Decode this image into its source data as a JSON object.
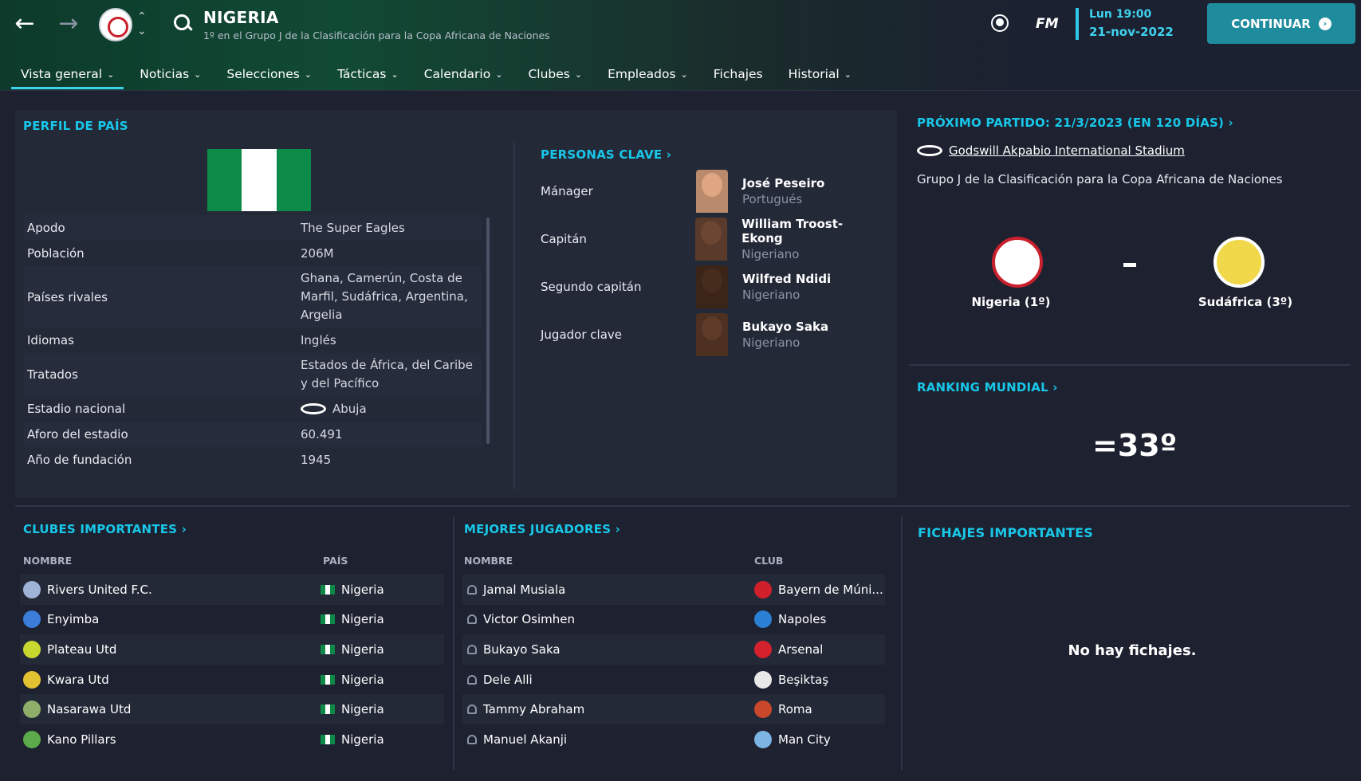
{
  "header": {
    "title": "NIGERIA",
    "subtitle": "1º en el Grupo J de la Clasificación para la Copa Africana de Naciones",
    "app_logo": "FM",
    "time": "Lun 19:00",
    "date": "21-nov-2022",
    "continue_label": "CONTINUAR"
  },
  "menu": [
    {
      "label": "Vista general",
      "has_dropdown": true,
      "active": true
    },
    {
      "label": "Noticias",
      "has_dropdown": true
    },
    {
      "label": "Selecciones",
      "has_dropdown": true
    },
    {
      "label": "Tácticas",
      "has_dropdown": true
    },
    {
      "label": "Calendario",
      "has_dropdown": true
    },
    {
      "label": "Clubes",
      "has_dropdown": true
    },
    {
      "label": "Empleados",
      "has_dropdown": true
    },
    {
      "label": "Fichajes",
      "has_dropdown": false
    },
    {
      "label": "Historial",
      "has_dropdown": true
    }
  ],
  "profile": {
    "title": "PERFIL DE PAÍS",
    "flag_colors": [
      "#0e8a48",
      "#ffffff",
      "#0e8a48"
    ],
    "rows": [
      {
        "label": "Apodo",
        "value": "The Super Eagles"
      },
      {
        "label": "Población",
        "value": "206M"
      },
      {
        "label": "Países rivales",
        "value": "Ghana, Camerún, Costa de Marfil, Sudáfrica, Argentina, Argelia"
      },
      {
        "label": "Idiomas",
        "value": "Inglés"
      },
      {
        "label": "Tratados",
        "value": "Estados de África, del Caribe y del Pacífico"
      },
      {
        "label": "Estadio nacional",
        "value": "Abuja",
        "icon": "stadium-icon"
      },
      {
        "label": "Aforo del estadio",
        "value": "60.491"
      },
      {
        "label": "Año de fundación",
        "value": "1945"
      }
    ]
  },
  "key_people": {
    "title": "PERSONAS CLAVE",
    "rows": [
      {
        "role": "Mánager",
        "name": "José Peseiro",
        "nationality": "Portugués",
        "face": "#b98a6c"
      },
      {
        "role": "Capitán",
        "name": "William Troost-Ekong",
        "nationality": "Nigeriano",
        "face": "#5a3a2a"
      },
      {
        "role": "Segundo capitán",
        "name": "Wilfred Ndidi",
        "nationality": "Nigeriano",
        "face": "#3a2518"
      },
      {
        "role": "Jugador clave",
        "name": "Bukayo Saka",
        "nationality": "Nigeriano",
        "face": "#4e3022"
      }
    ]
  },
  "next_match": {
    "title": "PRÓXIMO PARTIDO: 21/3/2023 (EN 120 DÍAS)",
    "stadium": "Godswill Akpabio International Stadium",
    "competition": "Grupo J de la Clasificación para la Copa Africana de Naciones",
    "home": "Nigeria (1º)",
    "away": "Sudáfrica (3º)",
    "home_color": "#c8202c",
    "away_color": "#f1d84a"
  },
  "ranking": {
    "title": "RANKING MUNDIAL",
    "value": "=33º"
  },
  "clubs": {
    "title": "CLUBES IMPORTANTES",
    "col_name": "NOMBRE",
    "col_country": "PAÍS",
    "rows": [
      {
        "name": "Rivers United F.C.",
        "country": "Nigeria",
        "badge": "#9fb3d8"
      },
      {
        "name": "Enyimba",
        "country": "Nigeria",
        "badge": "#3b7dd8"
      },
      {
        "name": "Plateau Utd",
        "country": "Nigeria",
        "badge": "#c9d82f"
      },
      {
        "name": "Kwara Utd",
        "country": "Nigeria",
        "badge": "#e3c232"
      },
      {
        "name": "Nasarawa Utd",
        "country": "Nigeria",
        "badge": "#8fae6a"
      },
      {
        "name": "Kano Pillars",
        "country": "Nigeria",
        "badge": "#5caa4a"
      }
    ]
  },
  "players": {
    "title": "MEJORES JUGADORES",
    "col_name": "NOMBRE",
    "col_club": "CLUB",
    "rows": [
      {
        "name": "Jamal Musiala",
        "club": "Bayern de Múni...",
        "badge": "#d0202c"
      },
      {
        "name": "Victor Osimhen",
        "club": "Napoles",
        "badge": "#2b7fd4"
      },
      {
        "name": "Bukayo Saka",
        "club": "Arsenal",
        "badge": "#d3212e"
      },
      {
        "name": "Dele Alli",
        "club": "Beşiktaş",
        "badge": "#e8e8e8"
      },
      {
        "name": "Tammy Abraham",
        "club": "Roma",
        "badge": "#c9472a"
      },
      {
        "name": "Manuel Akanji",
        "club": "Man City",
        "badge": "#7cb4e4"
      }
    ]
  },
  "transfers": {
    "title": "FICHAJES IMPORTANTES",
    "empty": "No hay fichajes."
  }
}
